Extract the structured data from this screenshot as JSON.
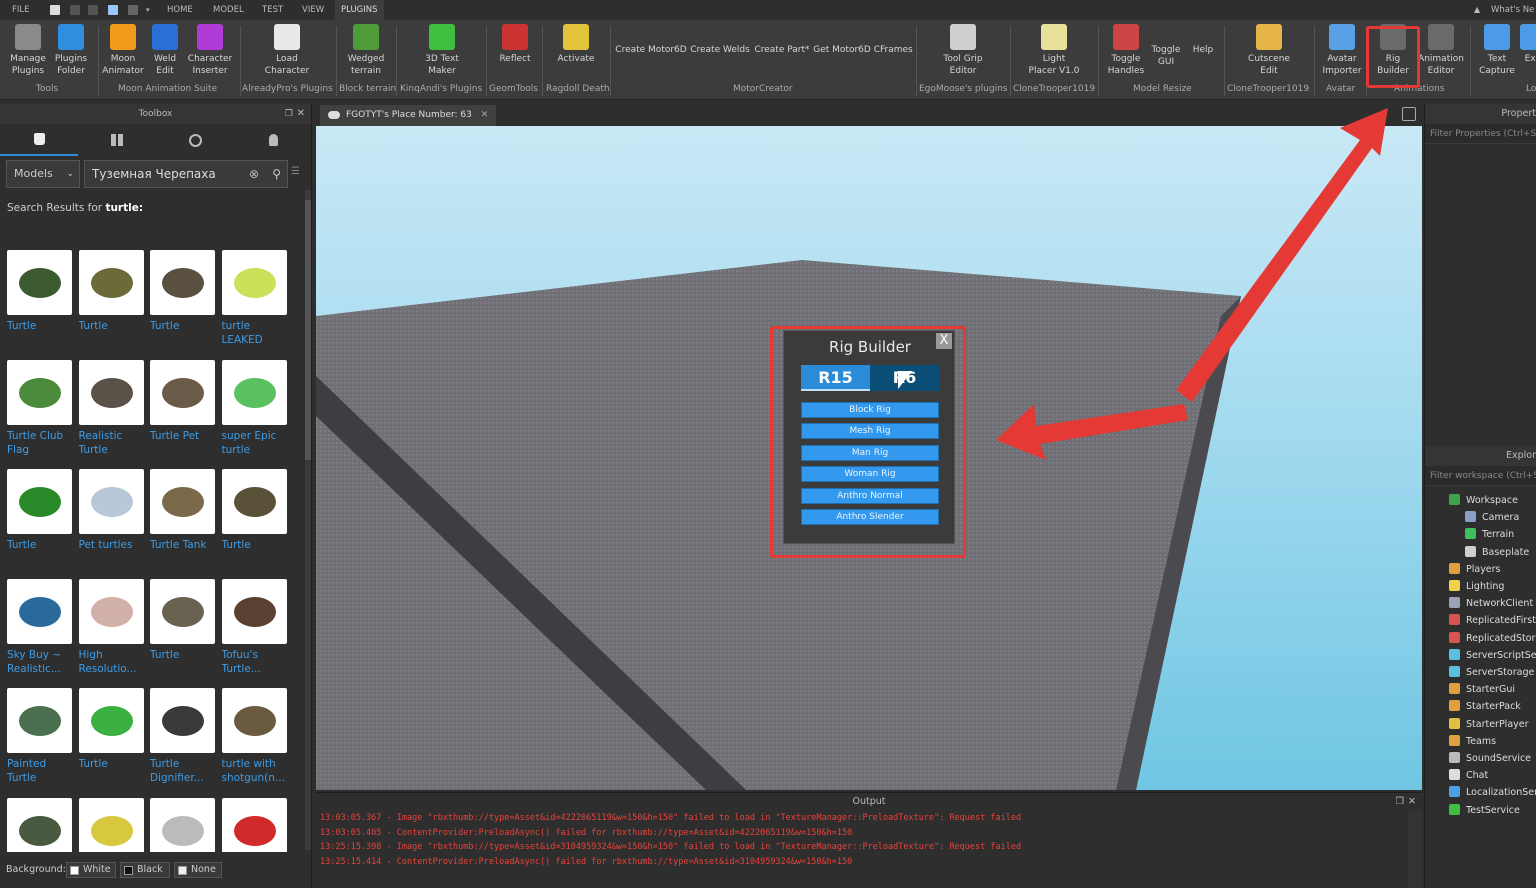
{
  "menu": {
    "file": "FILE",
    "tabs": [
      "HOME",
      "MODEL",
      "TEST",
      "VIEW",
      "PLUGINS"
    ],
    "whats_new": "What's Ne"
  },
  "ribbon": {
    "tools": [
      {
        "id": "manage-plugins",
        "label": "Manage\nPlugins",
        "color": "#8a8a8a"
      },
      {
        "id": "plugins-folder",
        "label": "Plugins\nFolder",
        "color": "#2f8ee0"
      },
      {
        "id": "moon-animator",
        "label": "Moon\nAnimator",
        "color": "#f29a1b"
      },
      {
        "id": "weld-edit",
        "label": "Weld\nEdit",
        "color": "#2a6fd6"
      },
      {
        "id": "character-inserter",
        "label": "Character\nInserter",
        "color": "#b13bd6"
      },
      {
        "id": "load-character",
        "label": "Load\nCharacter",
        "color": "#e9e9e9"
      },
      {
        "id": "wedged-terrain",
        "label": "Wedged\nterrain",
        "color": "#4f9b3a"
      },
      {
        "id": "3d-text-maker",
        "label": "3D Text\nMaker",
        "color": "#3fbe3f"
      },
      {
        "id": "reflect",
        "label": "Reflect",
        "color": "#c33"
      },
      {
        "id": "activate",
        "label": "Activate",
        "color": "#e2c43a"
      },
      {
        "id": "create-motor6d",
        "label": "Create Motor6D"
      },
      {
        "id": "create-welds",
        "label": "Create Welds"
      },
      {
        "id": "create-part",
        "label": "Create Part*"
      },
      {
        "id": "get-motor6d-cframes",
        "label": "Get Motor6D CFrames"
      },
      {
        "id": "tool-grip-editor",
        "label": "Tool Grip\nEditor",
        "color": "#cfcfcf"
      },
      {
        "id": "light-placer",
        "label": "Light\nPlacer V1.0",
        "color": "#e7e19a"
      },
      {
        "id": "toggle-handles",
        "label": "Toggle\nHandles",
        "color": "#c44"
      },
      {
        "id": "toggle-gui",
        "label": "Toggle\nGUI"
      },
      {
        "id": "help",
        "label": "Help"
      },
      {
        "id": "cutscene-edit",
        "label": "Cutscene\nEdit",
        "color": "#e6b54a"
      },
      {
        "id": "avatar-importer",
        "label": "Avatar\nImporter",
        "color": "#5aa0e6"
      },
      {
        "id": "rig-builder",
        "label": "Rig\nBuilder",
        "color": "#6a6a6a"
      },
      {
        "id": "animation-editor",
        "label": "Animation\nEditor",
        "color": "#6a6a6a"
      },
      {
        "id": "text-capture",
        "label": "Text\nCapture",
        "color": "#4d9be6"
      },
      {
        "id": "export",
        "label": "Exp",
        "color": "#4d9be6"
      }
    ],
    "groups": [
      "Tools",
      "Moon Animation Suite",
      "AlreadyPro's Plugins",
      "Block terrain",
      "KinqAndi's Plugins",
      "GeomTools",
      "Ragdoll Death",
      "MotorCreator",
      "EgoMoose's plugins",
      "CloneTrooper1019",
      "Model Resize",
      "CloneTrooper1019",
      "Avatar",
      "Animations",
      "Lo"
    ]
  },
  "toolbox": {
    "title": "Toolbox",
    "category": "Models",
    "search_value": "Туземная Черепаха",
    "results_prefix": "Search Results for ",
    "results_query": "turtle:",
    "items": [
      "Turtle",
      "Turtle",
      "Turtle",
      "turtle LEAKED",
      "Turtle Club Flag",
      "Realistic Turtle",
      "Turtle Pet",
      "super Epic turtle",
      "Turtle",
      "Pet turtles",
      "Turtle Tank",
      "Turtle",
      "Sky Buy ~ Realistic...",
      "High Resolutio...",
      "Turtle",
      "Tofuu's Turtle...",
      "Painted Turtle",
      "Turtle",
      "Turtle Dignifier...",
      "turtle with shotgun(n...",
      "",
      "",
      "",
      ""
    ],
    "background_label": "Background:",
    "bg_options": [
      "White",
      "Black",
      "None"
    ]
  },
  "document": {
    "tab_title": "FGOTYT's Place Number: 63"
  },
  "rig_builder": {
    "title": "Rig Builder",
    "close": "X",
    "tab_r15": "R15",
    "tab_r6": "R6",
    "buttons": [
      "Block Rig",
      "Mesh Rig",
      "Man Rig",
      "Woman Rig",
      "Anthro Normal",
      "Anthro Slender"
    ]
  },
  "output": {
    "title": "Output",
    "lines": [
      "13:03:05.367 - Image \"rbxthumb://type=Asset&id=4222065119&w=150&h=150\" failed to load in \"TextureManager::PreloadTexture\": Request failed",
      "13:03:05.405 - ContentProvider:PreloadAsync() failed for rbxthumb://type=Asset&id=4222065119&w=150&h=150",
      "13:25:15.398 - Image \"rbxthumb://type=Asset&id=3104959324&w=150&h=150\" failed to load in \"TextureManager::PreloadTexture\": Request failed",
      "13:25:15.414 - ContentProvider:PreloadAsync() failed for rbxthumb://type=Asset&id=3104959324&w=150&h=150"
    ]
  },
  "properties": {
    "title": "Propert",
    "filter": "Filter Properties (Ctrl+Sh"
  },
  "explorer": {
    "title": "Explor",
    "filter": "Filter workspace (Ctrl+Sh",
    "items": [
      {
        "label": "Workspace",
        "color": "#3fa34d"
      },
      {
        "label": "Camera",
        "color": "#8aa0c8"
      },
      {
        "label": "Terrain",
        "color": "#3fbf5f"
      },
      {
        "label": "Baseplate",
        "color": "#cfcfcf"
      },
      {
        "label": "Players",
        "color": "#e0a040"
      },
      {
        "label": "Lighting",
        "color": "#f1d24a"
      },
      {
        "label": "NetworkClient",
        "color": "#9aa4b4"
      },
      {
        "label": "ReplicatedFirst",
        "color": "#d9534f"
      },
      {
        "label": "ReplicatedStora",
        "color": "#d9534f"
      },
      {
        "label": "ServerScriptServ",
        "color": "#5bc0de"
      },
      {
        "label": "ServerStorage",
        "color": "#5bc0de"
      },
      {
        "label": "StarterGui",
        "color": "#e0a040"
      },
      {
        "label": "StarterPack",
        "color": "#e0a040"
      },
      {
        "label": "StarterPlayer",
        "color": "#e0c040"
      },
      {
        "label": "Teams",
        "color": "#e0a040"
      },
      {
        "label": "SoundService",
        "color": "#bbbbbb"
      },
      {
        "label": "Chat",
        "color": "#dddddd"
      },
      {
        "label": "LocalizationServ",
        "color": "#4aa0e6"
      },
      {
        "label": "TestService",
        "color": "#3fbf3f"
      }
    ]
  }
}
